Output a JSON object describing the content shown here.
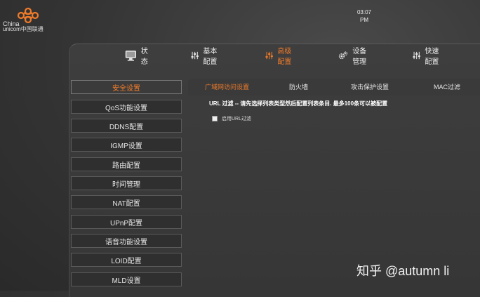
{
  "brand": {
    "line1": "China",
    "line2": "unicom中国联通",
    "accent": "#f07b2a"
  },
  "clock": {
    "time": "03:07",
    "ampm": "PM"
  },
  "nav": {
    "items": [
      {
        "label": "状态",
        "icon": "monitor-icon"
      },
      {
        "label": "基本配置",
        "icon": "sliders-icon"
      },
      {
        "label": "高级配置",
        "icon": "sliders-icon",
        "active": true
      },
      {
        "label": "设备管理",
        "icon": "gears-icon"
      },
      {
        "label": "快速配置",
        "icon": "sliders-icon"
      }
    ]
  },
  "sidebar": {
    "items": [
      {
        "label": "安全设置",
        "active": true
      },
      {
        "label": "QoS功能设置"
      },
      {
        "label": "DDNS配置"
      },
      {
        "label": "IGMP设置"
      },
      {
        "label": "路由配置"
      },
      {
        "label": "时间管理"
      },
      {
        "label": "NAT配置"
      },
      {
        "label": "UPnP配置"
      },
      {
        "label": "语音功能设置"
      },
      {
        "label": "LOID配置"
      },
      {
        "label": "MLD设置"
      }
    ]
  },
  "tabs": [
    {
      "label": "广域网访问设置",
      "active": true
    },
    {
      "label": "防火墙"
    },
    {
      "label": "攻击保护设置"
    },
    {
      "label": "MAC过滤"
    }
  ],
  "content": {
    "description": "URL 过滤 -- 请先选择列表类型然后配置列表条目. 最多100条可以被配置",
    "checkbox_label": "启用URL过滤",
    "checkbox_checked": false
  },
  "watermark": "知乎 @autumn li"
}
